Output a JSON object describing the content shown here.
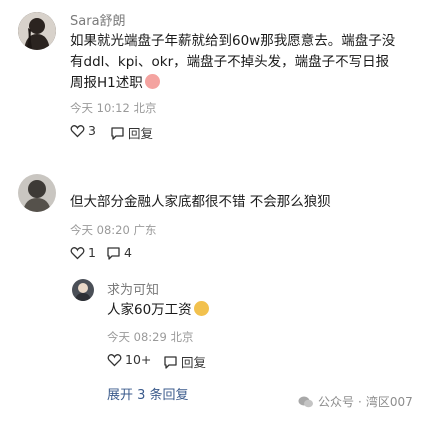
{
  "comments": [
    {
      "user": "Sara舒朗",
      "text_line1": "如果就光端盘子年薪就给到60w那我愿意去。端盘子没",
      "text_line2": "有ddl、kpi、okr，端盘子不掉头发，端盘子不写日报",
      "text_line3": "周报H1述职",
      "time": "今天 10:12 北京",
      "likes": "3",
      "reply_label": "回复"
    },
    {
      "user": "",
      "text": "但大部分金融人家底都很不错 不会那么狼狈",
      "time": "今天 08:20 广东",
      "likes": "1",
      "replies_count": "4",
      "reply": {
        "user": "求为可知",
        "text": "人家60万工资",
        "time": "今天 08:29 北京",
        "likes": "10+",
        "reply_label": "回复"
      },
      "expand_label": "展开 3 条回复"
    }
  ],
  "watermark": {
    "source": "公众号",
    "separator": "·",
    "author": "湾区007"
  },
  "icons": [
    "heart-icon",
    "comment-icon",
    "wechat-icon",
    "emoji-icon"
  ],
  "colors": {
    "link": "#3b5b8c",
    "meta": "#9a9a9a",
    "text": "#1a1a1a"
  }
}
